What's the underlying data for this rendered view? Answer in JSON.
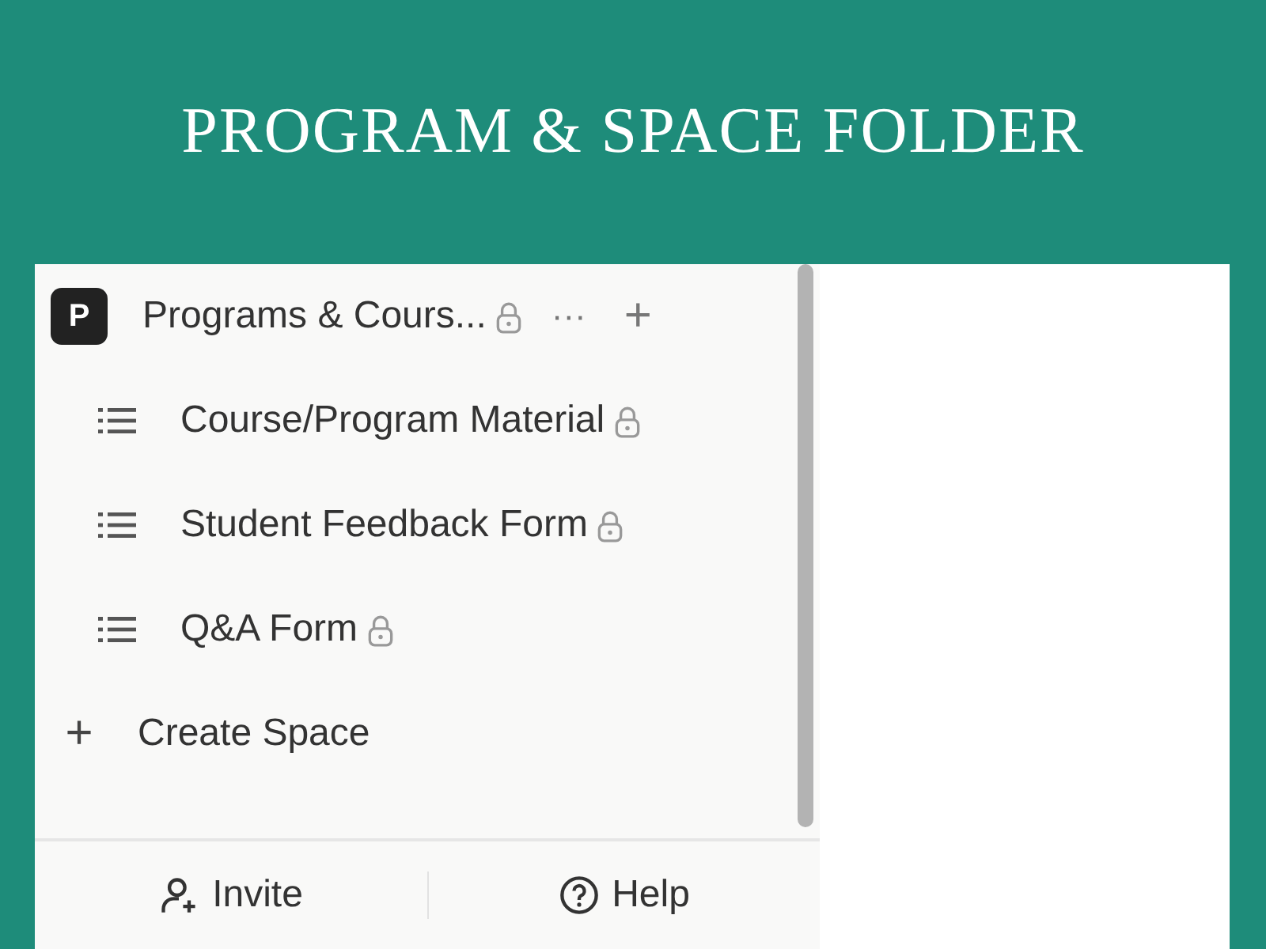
{
  "banner": {
    "title": "PROGRAM & SPACE FOLDER"
  },
  "space": {
    "badge": "P",
    "name": "Programs & Cours...",
    "locked": true,
    "more": "···",
    "add": "+"
  },
  "items": [
    {
      "label": "Course/Program Material",
      "locked": true
    },
    {
      "label": "Student Feedback Form",
      "locked": true
    },
    {
      "label": "Q&A Form",
      "locked": true
    }
  ],
  "create": {
    "icon": "+",
    "label": "Create Space"
  },
  "footer": [
    {
      "kind": "invite",
      "label": "Invite"
    },
    {
      "kind": "help",
      "label": "Help"
    }
  ]
}
